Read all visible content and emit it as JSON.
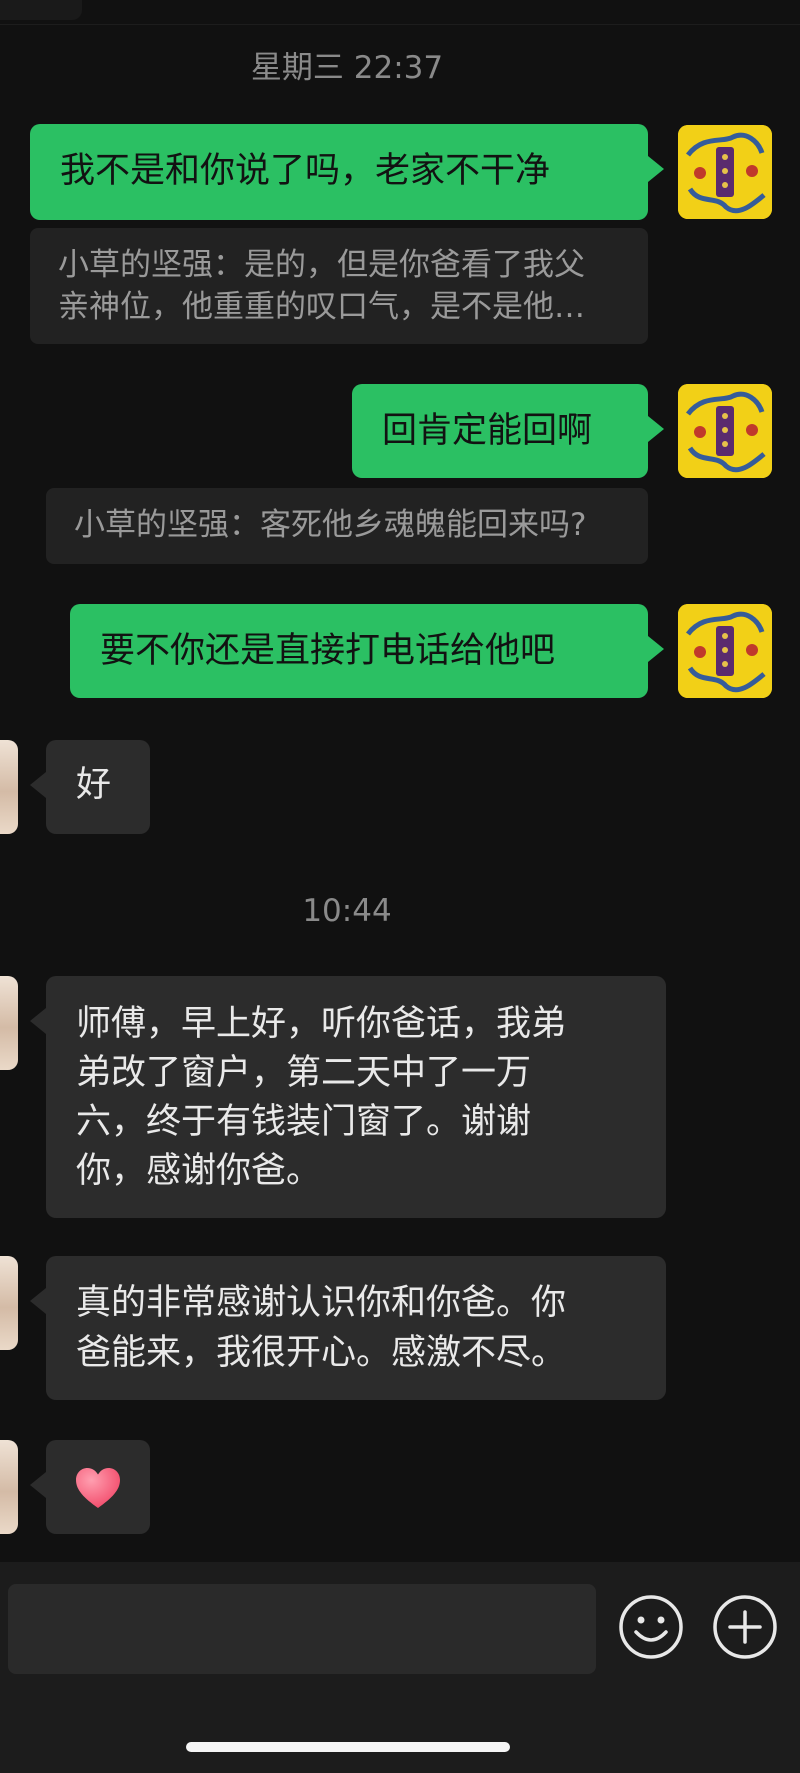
{
  "timestamps": {
    "first": "星期三 22:37",
    "second": "10:44"
  },
  "messages": {
    "m1": "我不是和你说了吗，老家不干净",
    "q1": {
      "line1": "小草的坚强：是的，但是你爸看了我父",
      "line2": "亲神位，他重重的叹口气，是不是他…"
    },
    "m2": "回肯定能回啊",
    "q2": "小草的坚强：客死他乡魂魄能回来吗?",
    "m3": "要不你还是直接打电话给他吧",
    "r1": "好",
    "r2": {
      "line1": "师傅，早上好，听你爸话，我弟",
      "line2": "弟改了窗户，第二天中了一万",
      "line3": "六，终于有钱装门窗了。谢谢",
      "line4": "你，感谢你爸。"
    },
    "r3": {
      "line1": "真的非常感谢认识你和你爸。你",
      "line2": "爸能来，我很开心。感激不尽。"
    },
    "r4": "heart-emoji"
  },
  "input": {
    "placeholder": ""
  },
  "icons": {
    "emoji": "smiley-icon",
    "more": "plus-icon"
  },
  "colors": {
    "outgoing_bubble": "#2bc063",
    "incoming_bubble": "#2c2c2c",
    "background": "#111111",
    "heart": "#f24a6a"
  }
}
